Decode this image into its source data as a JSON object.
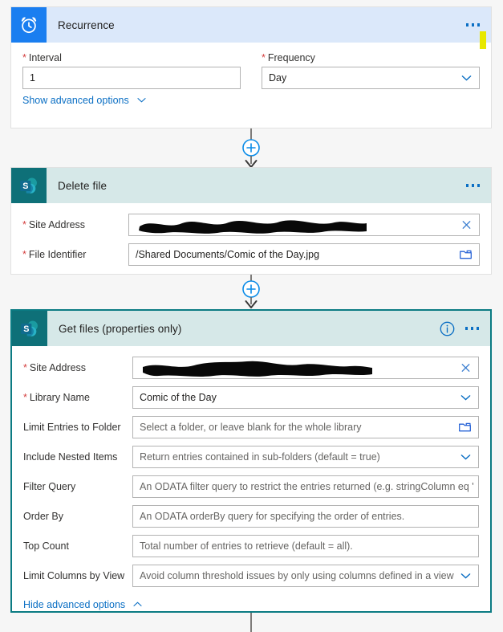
{
  "canvas": {
    "background": "#f6f6f6",
    "accent_blue": "#0b6fc4",
    "sharepoint_teal": "#0e7078",
    "recurrence_blue": "#1a7ef0",
    "selection_teal": "#0b7b83",
    "highlight_yellow": "#e8e800"
  },
  "cards": [
    {
      "id": "recurrence",
      "title": "Recurrence",
      "icon": "alarm-clock-icon",
      "header_color": "#dbe8fa",
      "selected": false,
      "menu_label": "...",
      "has_highlight_marker": true,
      "fields": [
        {
          "label": "Interval",
          "required": true,
          "value": "1",
          "control": "text"
        },
        {
          "label": "Frequency",
          "required": true,
          "value": "Day",
          "control": "dropdown"
        }
      ],
      "advanced_link": "Show advanced options",
      "advanced_state": "collapsed"
    },
    {
      "id": "delete-file",
      "title": "Delete file",
      "icon": "sharepoint-icon",
      "header_color": "#d6e8e8",
      "selected": false,
      "menu_label": "...",
      "fields": [
        {
          "label": "Site Address",
          "required": true,
          "value": "",
          "redacted": true,
          "control": "clear"
        },
        {
          "label": "File Identifier",
          "required": true,
          "value": "/Shared Documents/Comic of the Day.jpg",
          "control": "folder-picker"
        }
      ]
    },
    {
      "id": "get-files-properties-only",
      "title": "Get files (properties only)",
      "icon": "sharepoint-icon",
      "header_color": "#d6e8e8",
      "selected": true,
      "menu_label": "...",
      "has_info_icon": true,
      "fields": [
        {
          "label": "Site Address",
          "required": true,
          "value": "",
          "redacted": true,
          "control": "clear"
        },
        {
          "label": "Library Name",
          "required": true,
          "value": "Comic of the Day",
          "control": "dropdown"
        },
        {
          "label": "Limit Entries to Folder",
          "required": false,
          "placeholder": "Select a folder, or leave blank for the whole library",
          "control": "folder-picker"
        },
        {
          "label": "Include Nested Items",
          "required": false,
          "placeholder": "Return entries contained in sub-folders (default = true)",
          "control": "dropdown"
        },
        {
          "label": "Filter Query",
          "required": false,
          "placeholder": "An ODATA filter query to restrict the entries returned (e.g. stringColumn eq 'stri",
          "control": "text"
        },
        {
          "label": "Order By",
          "required": false,
          "placeholder": "An ODATA orderBy query for specifying the order of entries.",
          "control": "text"
        },
        {
          "label": "Top Count",
          "required": false,
          "placeholder": "Total number of entries to retrieve (default = all).",
          "control": "text"
        },
        {
          "label": "Limit Columns by View",
          "required": false,
          "placeholder": "Avoid column threshold issues by only using columns defined in a view",
          "control": "dropdown"
        }
      ],
      "advanced_link": "Hide advanced options",
      "advanced_state": "expanded"
    }
  ],
  "connectors": [
    {
      "id": "connector-1",
      "add_button": "+",
      "between": "recurrence → delete-file"
    },
    {
      "id": "connector-2",
      "add_button": "+",
      "between": "delete-file → get-files-properties-only"
    }
  ]
}
